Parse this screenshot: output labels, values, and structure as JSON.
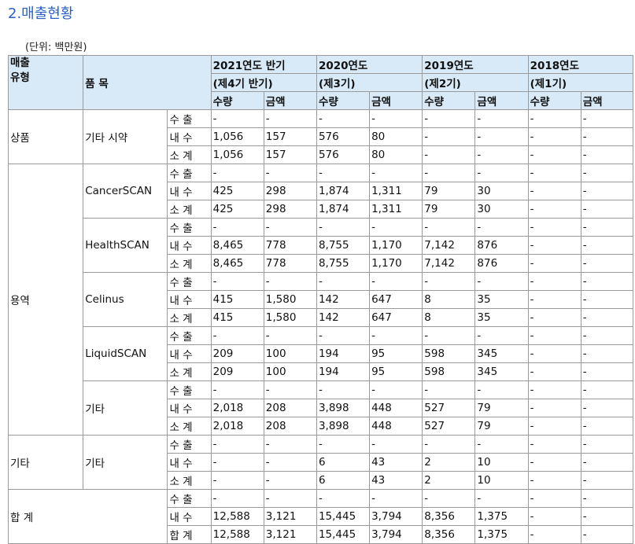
{
  "page": {
    "title": "2.매출현황",
    "unit": "(단위: 백만원)"
  },
  "header": {
    "col1": [
      "매출",
      "유형"
    ],
    "col2": "품 목",
    "years": [
      {
        "year": "2021연도 반기",
        "period": "(제4기 반기)"
      },
      {
        "year": "2020연도",
        "period": "(제3기)"
      },
      {
        "year": "2019연도",
        "period": "(제2기)"
      },
      {
        "year": "2018연도",
        "period": "(제1기)"
      }
    ],
    "qty": "수량",
    "amt": "금액"
  },
  "groups": [
    {
      "type": "상품",
      "items": [
        {
          "name": "기타 시약",
          "rows": [
            {
              "kind": "수 출",
              "v": [
                "-",
                "-",
                "-",
                "-",
                "-",
                "-",
                "-",
                "-"
              ]
            },
            {
              "kind": "내 수",
              "v": [
                "1,056",
                "157",
                "576",
                "80",
                "-",
                "-",
                "-",
                "-"
              ]
            },
            {
              "kind": "소 계",
              "v": [
                "1,056",
                "157",
                "576",
                "80",
                "-",
                "-",
                "-",
                "-"
              ]
            }
          ]
        }
      ]
    },
    {
      "type": "용역",
      "items": [
        {
          "name": "CancerSCAN",
          "rows": [
            {
              "kind": "수 출",
              "v": [
                "-",
                "-",
                "-",
                "-",
                "-",
                "-",
                "-",
                "-"
              ]
            },
            {
              "kind": "내 수",
              "v": [
                "425",
                "298",
                "1,874",
                "1,311",
                "79",
                "30",
                "-",
                "-"
              ]
            },
            {
              "kind": "소 계",
              "v": [
                "425",
                "298",
                "1,874",
                "1,311",
                "79",
                "30",
                "-",
                "-"
              ]
            }
          ]
        },
        {
          "name": "HealthSCAN",
          "rows": [
            {
              "kind": "수 출",
              "v": [
                "-",
                "-",
                "-",
                "-",
                "-",
                "-",
                "-",
                "-"
              ]
            },
            {
              "kind": "내 수",
              "v": [
                "8,465",
                "778",
                "8,755",
                "1,170",
                "7,142",
                "876",
                "-",
                "-"
              ]
            },
            {
              "kind": "소 계",
              "v": [
                "8,465",
                "778",
                "8,755",
                "1,170",
                "7,142",
                "876",
                "-",
                "-"
              ]
            }
          ]
        },
        {
          "name": "Celinus",
          "rows": [
            {
              "kind": "수 출",
              "v": [
                "-",
                "-",
                "-",
                "-",
                "-",
                "-",
                "-",
                "-"
              ]
            },
            {
              "kind": "내 수",
              "v": [
                "415",
                "1,580",
                "142",
                "647",
                "8",
                "35",
                "-",
                "-"
              ]
            },
            {
              "kind": "소 계",
              "v": [
                "415",
                "1,580",
                "142",
                "647",
                "8",
                "35",
                "-",
                "-"
              ]
            }
          ]
        },
        {
          "name": "LiquidSCAN",
          "rows": [
            {
              "kind": "수 출",
              "v": [
                "-",
                "-",
                "-",
                "-",
                "-",
                "-",
                "-",
                "-"
              ]
            },
            {
              "kind": "내 수",
              "v": [
                "209",
                "100",
                "194",
                "95",
                "598",
                "345",
                "-",
                "-"
              ]
            },
            {
              "kind": "소 계",
              "v": [
                "209",
                "100",
                "194",
                "95",
                "598",
                "345",
                "-",
                "-"
              ]
            }
          ]
        },
        {
          "name": "기타",
          "rows": [
            {
              "kind": "수 출",
              "v": [
                "-",
                "-",
                "-",
                "-",
                "-",
                "-",
                "-",
                "-"
              ]
            },
            {
              "kind": "내 수",
              "v": [
                "2,018",
                "208",
                "3,898",
                "448",
                "527",
                "79",
                "-",
                "-"
              ]
            },
            {
              "kind": "소 계",
              "v": [
                "2,018",
                "208",
                "3,898",
                "448",
                "527",
                "79",
                "-",
                "-"
              ]
            }
          ]
        }
      ]
    },
    {
      "type": "기타",
      "items": [
        {
          "name": "기타",
          "rows": [
            {
              "kind": "수 출",
              "v": [
                "-",
                "-",
                "-",
                "-",
                "-",
                "-",
                "-",
                "-"
              ]
            },
            {
              "kind": "내 수",
              "v": [
                "-",
                "-",
                "6",
                "43",
                "2",
                "10",
                "-",
                "-"
              ]
            },
            {
              "kind": "소 계",
              "v": [
                "-",
                "-",
                "6",
                "43",
                "2",
                "10",
                "-",
                "-"
              ]
            }
          ]
        }
      ]
    }
  ],
  "total": {
    "label": "합 계",
    "rows": [
      {
        "kind": "수 출",
        "v": [
          "-",
          "-",
          "-",
          "-",
          "-",
          "-",
          "-",
          "-"
        ]
      },
      {
        "kind": "내 수",
        "v": [
          "12,588",
          "3,121",
          "15,445",
          "3,794",
          "8,356",
          "1,375",
          "-",
          "-"
        ]
      },
      {
        "kind": "합 계",
        "v": [
          "12,588",
          "3,121",
          "15,445",
          "3,794",
          "8,356",
          "1,375",
          "-",
          "-"
        ]
      }
    ]
  }
}
